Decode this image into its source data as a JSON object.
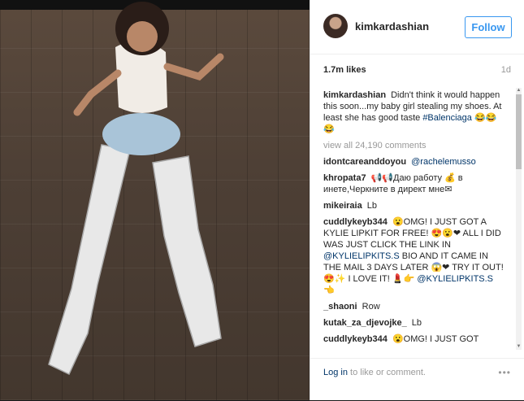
{
  "header": {
    "username": "kimkardashian",
    "follow_label": "Follow"
  },
  "stats": {
    "likes": "1.7m likes",
    "time": "1d"
  },
  "caption": {
    "user": "kimkardashian",
    "text": "Didn't think it would happen this soon...my baby girl stealing my shoes. At least she has good taste",
    "hashtag": "#Balenciaga",
    "emoji": "😂😂😂"
  },
  "view_all": "view all 24,190 comments",
  "comments": [
    {
      "user": "idontcareanddoyou",
      "text": "",
      "tag": "@rachelemusso",
      "after": ""
    },
    {
      "user": "khropata7",
      "text": "📢📢Даю работу 💰 в инете,Черкните в директ мне✉",
      "tag": "",
      "after": ""
    },
    {
      "user": "mikeiraia",
      "text": "Lb",
      "tag": "",
      "after": ""
    },
    {
      "user": "cuddlykeyb344",
      "text": "😮OMG! I JUST GOT A KYLIE LIPKIT FOR FREE! 😍😮❤ ALL I DID WAS JUST CLICK THE LINK IN",
      "tag": "@KYLIELIPKITS.S",
      "after": "BIO AND IT CAME IN THE MAIL 3 DAYS LATER 😱❤ TRY IT OUT! 😍✨ I LOVE IT! 💄👉"
    },
    {
      "user": "",
      "text": "",
      "tag": "@KYLIELIPKITS.S",
      "after": "👈"
    },
    {
      "user": "_shaoni",
      "text": "Row",
      "tag": "",
      "after": ""
    },
    {
      "user": "kutak_za_djevojke_",
      "text": "Lb",
      "tag": "",
      "after": ""
    },
    {
      "user": "cuddlykeyb344",
      "text": "😮OMG! I JUST GOT",
      "tag": "",
      "after": ""
    }
  ],
  "footer": {
    "login_link": "Log in",
    "login_text": "to like or comment.",
    "more": "•••"
  },
  "colors": {
    "accent": "#3897f0",
    "link": "#003569"
  }
}
